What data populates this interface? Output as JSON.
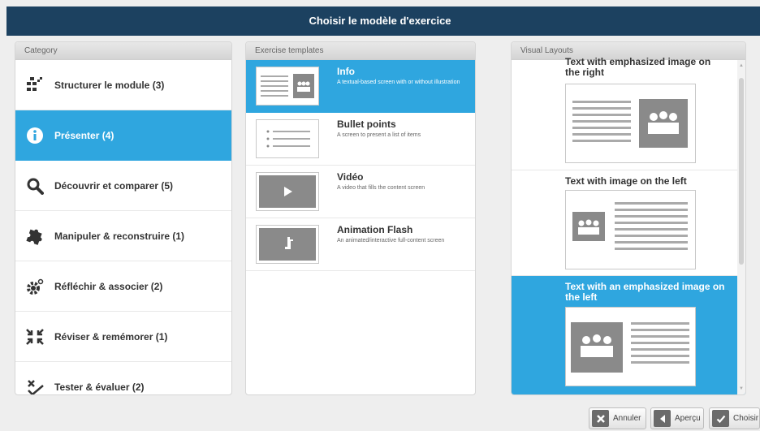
{
  "dialog": {
    "title": "Choisir le modèle d'exercice"
  },
  "category": {
    "header": "Category",
    "items": [
      {
        "label": "Structurer le module (3)",
        "icon": "structure-icon",
        "selected": false
      },
      {
        "label": "Présenter (4)",
        "icon": "info-icon",
        "selected": true
      },
      {
        "label": "Découvrir et comparer (5)",
        "icon": "magnifier-icon",
        "selected": false
      },
      {
        "label": "Manipuler & reconstruire (1)",
        "icon": "puzzle-icon",
        "selected": false
      },
      {
        "label": "Réfléchir & associer (2)",
        "icon": "gears-icon",
        "selected": false
      },
      {
        "label": "Réviser & remémorer (1)",
        "icon": "arrows-icon",
        "selected": false
      },
      {
        "label": "Tester & évaluer (2)",
        "icon": "check-cross-icon",
        "selected": false
      }
    ]
  },
  "templates": {
    "header": "Exercise templates",
    "items": [
      {
        "name": "Info",
        "description": "A textual-based screen with or without illustration",
        "thumb": "text-image-thumb",
        "selected": true
      },
      {
        "name": "Bullet points",
        "description": "A screen to present a list of items",
        "thumb": "bullets-thumb",
        "selected": false
      },
      {
        "name": "Vidéo",
        "description": "A video that fills the content screen",
        "thumb": "video-thumb",
        "selected": false
      },
      {
        "name": "Animation Flash",
        "description": "An animated/interactive full-content screen",
        "thumb": "flash-thumb",
        "selected": false
      }
    ]
  },
  "layouts": {
    "header": "Visual Layouts",
    "items": [
      {
        "name": "Text with emphasized image on the right",
        "selected": false
      },
      {
        "name": "Text with image on the left",
        "selected": false
      },
      {
        "name": "Text with an emphasized image on the left",
        "selected": true
      }
    ]
  },
  "buttons": {
    "cancel": "Annuler",
    "preview": "Aperçu",
    "choose": "Choisir"
  },
  "colors": {
    "accent": "#2fa6df",
    "titlebar": "#1c4160"
  }
}
